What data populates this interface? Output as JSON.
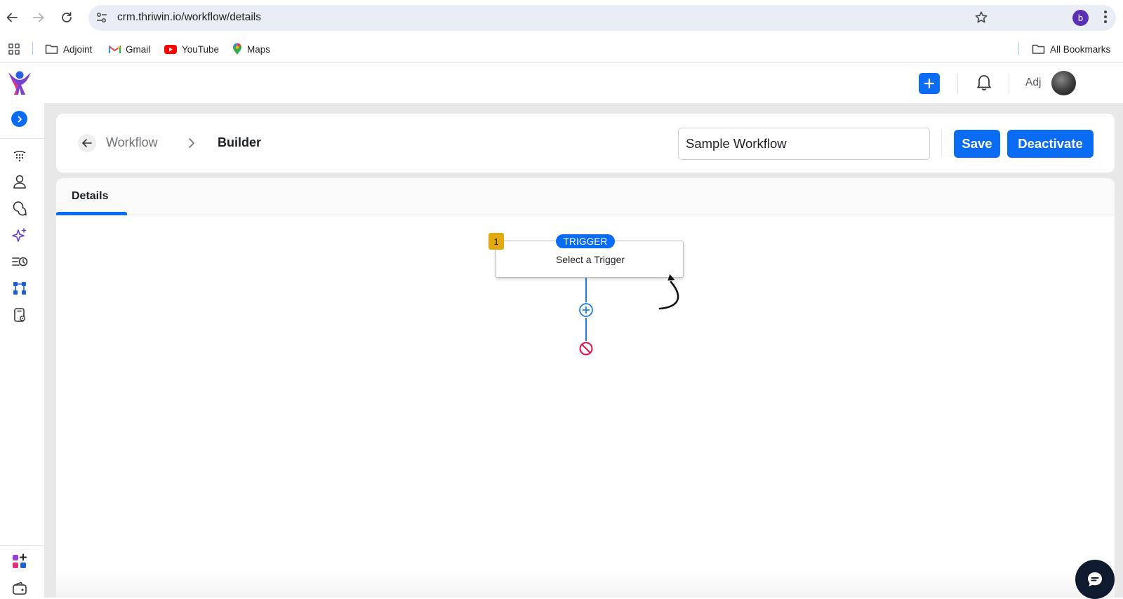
{
  "browser": {
    "url": "crm.thriwin.io/workflow/details",
    "profile_initial": "b",
    "bookmarks": [
      {
        "label": "Adjoint",
        "icon": "folder-icon"
      },
      {
        "label": "Gmail",
        "icon": "gmail-icon"
      },
      {
        "label": "YouTube",
        "icon": "youtube-icon"
      },
      {
        "label": "Maps",
        "icon": "maps-icon"
      }
    ],
    "all_bookmarks": "All Bookmarks"
  },
  "header": {
    "user_name": "Adj",
    "accent": "#0a6cf5"
  },
  "sidebar": {
    "items": [
      {
        "icon": "dialpad-icon"
      },
      {
        "icon": "contact-icon"
      },
      {
        "icon": "conversations-icon"
      },
      {
        "icon": "sparkle-ai-icon"
      },
      {
        "icon": "scheduled-list-icon"
      },
      {
        "icon": "workflow-icon"
      },
      {
        "icon": "device-settings-icon"
      }
    ],
    "bottom_items": [
      {
        "icon": "add-apps-icon"
      },
      {
        "icon": "wallet-icon"
      }
    ]
  },
  "page": {
    "breadcrumb": {
      "parent": "Workflow",
      "current": "Builder"
    },
    "workflow_name": "Sample Workflow",
    "save_label": "Save",
    "deactivate_label": "Deactivate",
    "tabs": [
      {
        "label": "Details",
        "active": true
      }
    ]
  },
  "workflow": {
    "step_number": "1",
    "trigger_badge": "TRIGGER",
    "trigger_text": "Select a Trigger",
    "colors": {
      "step_badge": "#e0aa10",
      "connector": "#1e7fe0",
      "end": "#e0144c"
    }
  }
}
